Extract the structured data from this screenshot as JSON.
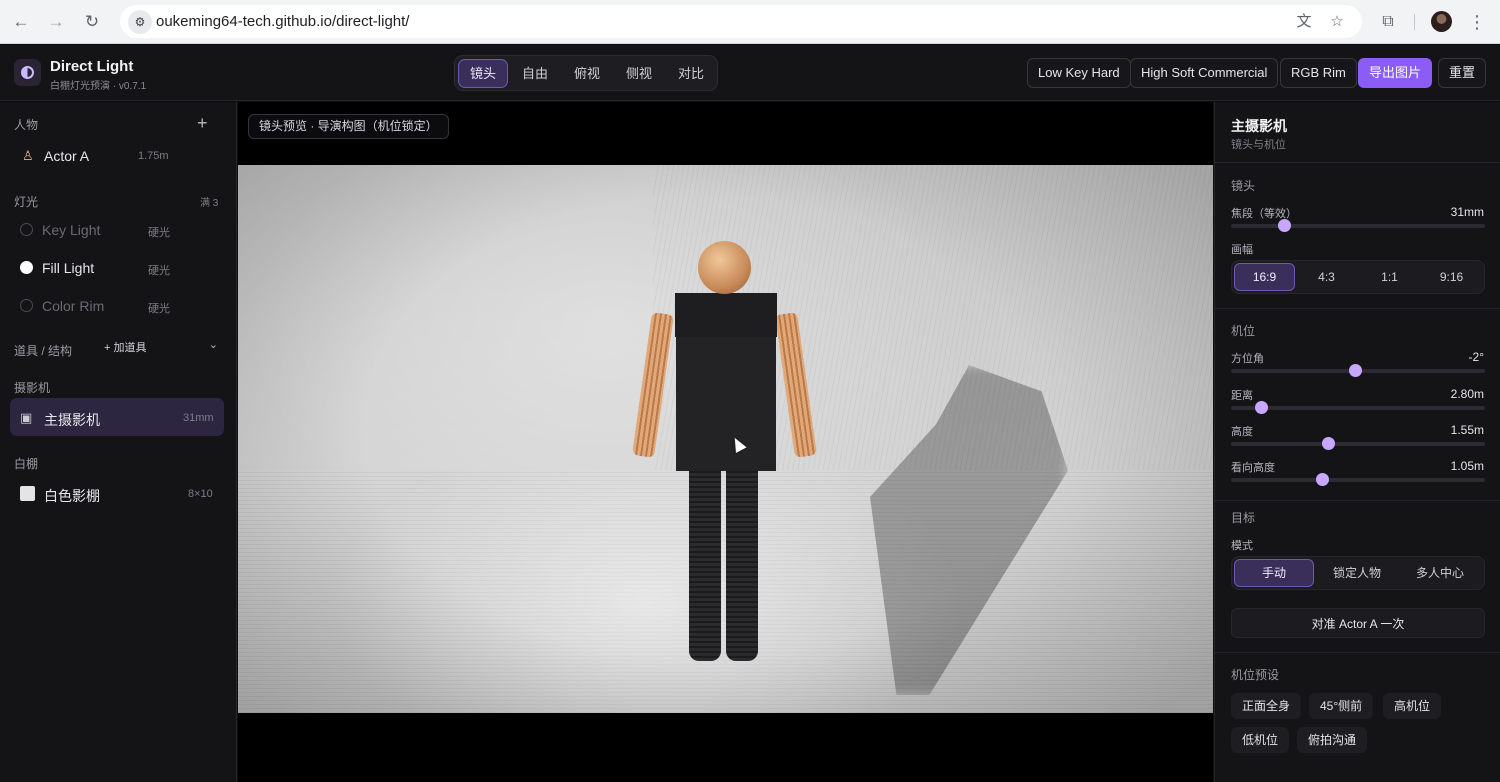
{
  "browser": {
    "url": "oukeming64-tech.github.io/direct-light/"
  },
  "header": {
    "title": "Direct Light",
    "subtitle": "白棚灯光预演 · v0.7.1",
    "view_modes": [
      "镜头",
      "自由",
      "俯视",
      "侧视",
      "对比"
    ],
    "active_view_mode": "镜头",
    "presets": [
      "Low Key Hard",
      "High Soft Commercial",
      "RGB Rim"
    ],
    "export_label": "导出图片",
    "reset_label": "重置"
  },
  "sidebar": {
    "people_header": "人物",
    "actors": [
      {
        "name": "Actor A",
        "height": "1.75m"
      }
    ],
    "lights_header": "灯光",
    "lights_count": "满 3",
    "lights": [
      {
        "name": "Key Light",
        "type": "硬光",
        "enabled": false
      },
      {
        "name": "Fill Light",
        "type": "硬光",
        "enabled": true
      },
      {
        "name": "Color Rim",
        "type": "硬光",
        "enabled": false
      }
    ],
    "props_header": "道具 / 结构",
    "add_prop_label": "+ 加道具",
    "cameras_header": "摄影机",
    "cameras": [
      {
        "name": "主摄影机",
        "focal": "31mm"
      }
    ],
    "studio_header": "白棚",
    "studio": [
      {
        "name": "白色影棚",
        "size": "8×10"
      }
    ]
  },
  "viewport": {
    "tag": "镜头预览 · 导演构图（机位锁定）"
  },
  "inspector": {
    "title": "主摄影机",
    "subtitle": "镜头与机位",
    "lens_header": "镜头",
    "focal_label": "焦段（等效）",
    "focal_value": "31mm",
    "focal_level": 0.21,
    "aspect_label": "画幅",
    "aspects": [
      "16:9",
      "4:3",
      "1:1",
      "9:16"
    ],
    "active_aspect": "16:9",
    "position_header": "机位",
    "sliders": [
      {
        "label": "方位角",
        "value": "-2°",
        "level": 0.49
      },
      {
        "label": "距离",
        "value": "2.80m",
        "level": 0.12
      },
      {
        "label": "高度",
        "value": "1.55m",
        "level": 0.38
      },
      {
        "label": "看向高度",
        "value": "1.05m",
        "level": 0.36
      }
    ],
    "target_header": "目标",
    "target_mode_label": "模式",
    "target_modes": [
      "手动",
      "锁定人物",
      "多人中心"
    ],
    "active_target_mode": "手动",
    "aim_button": "对准 Actor A 一次",
    "camera_presets_header": "机位预设",
    "camera_presets": [
      "正面全身",
      "45°侧前",
      "高机位",
      "低机位",
      "俯拍沟通"
    ]
  }
}
